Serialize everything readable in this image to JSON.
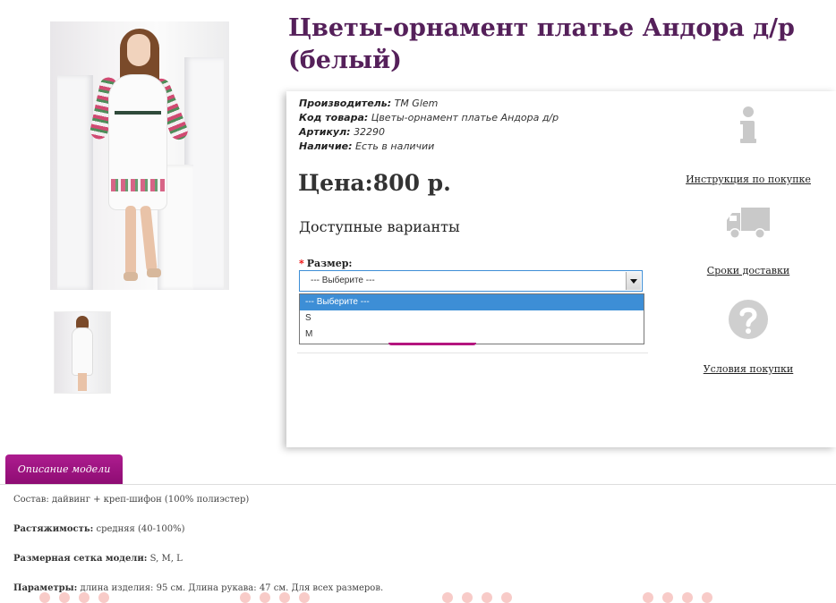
{
  "product": {
    "title": "Цветы-орнамент платье Андора д/р (белый)",
    "meta": [
      {
        "label": "Производитель:",
        "value": "TM Glem"
      },
      {
        "label": "Код товара:",
        "value": "Цветы-орнамент платье Андора д/р"
      },
      {
        "label": "Артикул:",
        "value": "32290"
      },
      {
        "label": "Наличие:",
        "value": "Есть в наличии"
      }
    ],
    "price": "Цена:800 р.",
    "variants_heading": "Доступные варианты",
    "size_label": "Размер:",
    "size_select": {
      "value": "--- Выберите ---",
      "options": [
        "--- Выберите ---",
        "S",
        "M"
      ]
    }
  },
  "sidebar": {
    "links": [
      {
        "label": "Инструкция по покупке",
        "icon": "info-icon"
      },
      {
        "label": "Сроки доставки",
        "icon": "delivery-truck-icon"
      },
      {
        "label": "Условия покупки",
        "icon": "question-icon"
      }
    ]
  },
  "tabs": {
    "description": "Описание модели"
  },
  "description": [
    {
      "label": "",
      "text": "Состав: дайвинг + креп-шифон (100% полиэстер)"
    },
    {
      "label": "Растяжимость:",
      "text": " средняя (40-100%)"
    },
    {
      "label": "Размерная сетка модели:",
      "text": " S, M, L"
    },
    {
      "label": "Параметры:",
      "text": " длина изделия: 95 см. Длина рукава: 47 см. Для всех размеров."
    }
  ]
}
